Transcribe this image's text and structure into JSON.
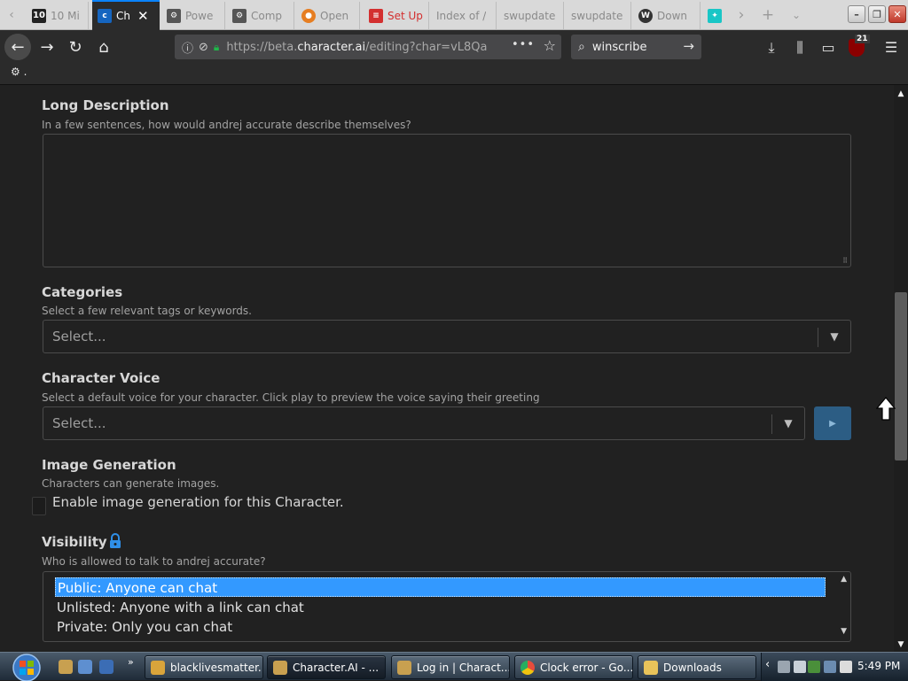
{
  "browser": {
    "tabs": [
      {
        "label": "10 Mi",
        "icon": "ten-icon",
        "color": "#222222"
      },
      {
        "label": "Ch",
        "icon": "character-ai-icon",
        "color": "#1565c0",
        "active": true
      },
      {
        "label": "Powe",
        "icon": "gear-icon",
        "color": "#555555"
      },
      {
        "label": "Comp",
        "icon": "gear-icon",
        "color": "#555555"
      },
      {
        "label": "Open",
        "icon": "openvpn-icon",
        "color": "#e67e22"
      },
      {
        "label": "Set Up",
        "icon": "lines-icon",
        "color": "#d32f2f"
      },
      {
        "label": "Index of /",
        "icon": "",
        "color": ""
      },
      {
        "label": "swupdate",
        "icon": "",
        "color": ""
      },
      {
        "label": "swupdate",
        "icon": "",
        "color": ""
      },
      {
        "label": "Down",
        "icon": "w-icon",
        "color": "#333333"
      },
      {
        "label": "",
        "icon": "bird-icon",
        "color": "#19c6c6"
      }
    ],
    "url_prefix": "https://beta.",
    "url_host": "character.ai",
    "url_path": "/editing?char=vL8Qa",
    "url_more": "•••",
    "search_value": "winscribe",
    "bookmark_label": ".",
    "ublock_count": "21"
  },
  "form": {
    "long_description": {
      "title": "Long Description",
      "hint": "In a few sentences, how would andrej accurate describe themselves?"
    },
    "categories": {
      "title": "Categories",
      "hint": "Select a few relevant tags or keywords.",
      "placeholder": "Select..."
    },
    "voice": {
      "title": "Character Voice",
      "hint": "Select a default voice for your character. Click play to preview the voice saying their greeting",
      "placeholder": "Select..."
    },
    "image_generation": {
      "title": "Image Generation",
      "hint": "Characters can generate images.",
      "checkbox_label": "Enable image generation for this Character."
    },
    "visibility": {
      "title": "Visibility",
      "hint": "Who is allowed to talk to andrej accurate?",
      "options": [
        "Public: Anyone can chat",
        "Unlisted: Anyone with a link can chat",
        "Private: Only you can chat"
      ]
    }
  },
  "taskbar": {
    "tasks": [
      {
        "label": "blacklivesmatter...",
        "color": "#d9a43b"
      },
      {
        "label": "Character.AI - ...",
        "color": "#c8a050"
      },
      {
        "label": "Log in | Charact...",
        "color": "#c8a050"
      },
      {
        "label": "Clock error - Go...",
        "color": "#e74c3c"
      },
      {
        "label": "Downloads",
        "color": "#e8c35a"
      }
    ],
    "clock": "5:49 PM"
  },
  "colors": {
    "accent": "#3399ff",
    "play_button": "#2c5d84",
    "lock": "#2f8fe8",
    "secure_lock": "#1fb84a"
  }
}
